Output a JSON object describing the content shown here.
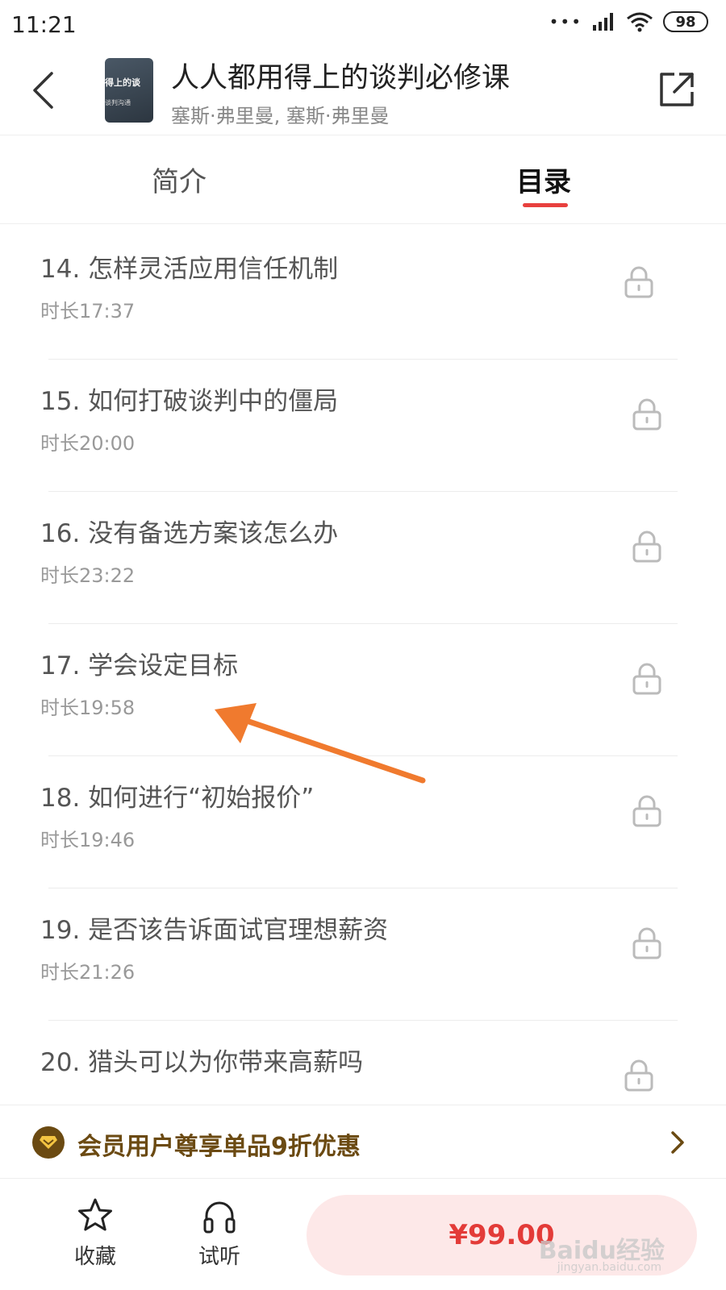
{
  "status_bar": {
    "time": "11:21",
    "battery": "98",
    "icons": [
      "signal-dots-icon",
      "cell-signal-icon",
      "wifi-icon",
      "battery-icon"
    ]
  },
  "header": {
    "title": "人人都用得上的谈判必修课",
    "author": "塞斯·弗里曼, 塞斯·弗里曼",
    "cover_text_1": "得上的谈",
    "cover_text_2": "谈判沟通"
  },
  "tabs": [
    {
      "label": "简介",
      "active": false
    },
    {
      "label": "目录",
      "active": true
    }
  ],
  "accent_color": "#e8403e",
  "catalog": [
    {
      "title": "14. 怎样灵活应用信任机制",
      "duration": "时长17:37",
      "locked": true
    },
    {
      "title": "15. 如何打破谈判中的僵局",
      "duration": "时长20:00",
      "locked": true
    },
    {
      "title": "16. 没有备选方案该怎么办",
      "duration": "时长23:22",
      "locked": true
    },
    {
      "title": "17. 学会设定目标",
      "duration": "时长19:58",
      "locked": true
    },
    {
      "title": "18. 如何进行“初始报价”",
      "duration": "时长19:46",
      "locked": true
    },
    {
      "title": "19. 是否该告诉面试官理想薪资",
      "duration": "时长21:26",
      "locked": true
    },
    {
      "title": "20. 猎头可以为你带来高薪吗",
      "duration": "",
      "locked": true
    }
  ],
  "member_banner": {
    "text": "会员用户尊享单品9折优惠",
    "color": "#6b4a12"
  },
  "bottom_bar": {
    "favorite_label": "收藏",
    "listen_label": "试听",
    "price": "¥99.00",
    "watermark": "Baidu经验",
    "watermark_sub": "jingyan.baidu.com"
  }
}
